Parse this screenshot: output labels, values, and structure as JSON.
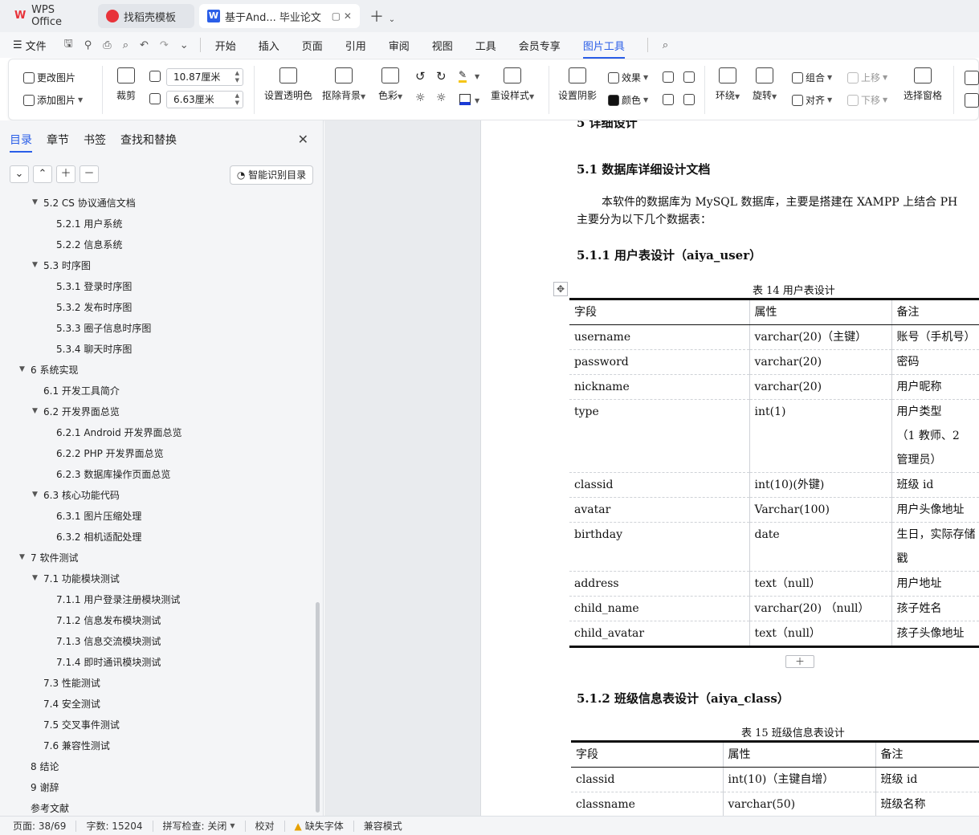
{
  "tabs": {
    "wps": "WPS Office",
    "template": "找稻壳模板",
    "doc": "基于And... 毕业论文"
  },
  "menu": {
    "file": "文件",
    "items": [
      "开始",
      "插入",
      "页面",
      "引用",
      "审阅",
      "视图",
      "工具",
      "会员专享",
      "图片工具"
    ],
    "active": "图片工具"
  },
  "ribbon": {
    "change_image": "更改图片",
    "add_image": "添加图片",
    "crop": "裁剪",
    "cut": "裁剪",
    "width": "10.87厘米",
    "height": "6.63厘米",
    "set_transparent": "设置透明色",
    "remove_bg": "抠除背景",
    "color": "色彩",
    "preset_style": "重设样式",
    "set_shadow": "设置阴影",
    "effect": "效果",
    "fill_color": "颜色",
    "wrap": "环绕",
    "rotate": "旋转",
    "group": "组合",
    "align": "对齐",
    "move_up": "上移",
    "move_down": "下移",
    "select_pane": "选择窗格"
  },
  "panel": {
    "tabs": [
      "目录",
      "章节",
      "书签",
      "查找和替换"
    ],
    "smart_toc": "智能识别目录",
    "toc": [
      {
        "text": "5.2  CS 协议通信文档",
        "level": 2,
        "arrow": true
      },
      {
        "text": "5.2.1  用户系统",
        "level": 3
      },
      {
        "text": "5.2.2  信息系统",
        "level": 3
      },
      {
        "text": "5.3  时序图",
        "level": 2,
        "arrow": true
      },
      {
        "text": "5.3.1  登录时序图",
        "level": 3
      },
      {
        "text": "5.3.2  发布时序图",
        "level": 3
      },
      {
        "text": "5.3.3  圈子信息时序图",
        "level": 3
      },
      {
        "text": "5.3.4  聊天时序图",
        "level": 3
      },
      {
        "text": "6  系统实现",
        "level": 1,
        "arrow": true
      },
      {
        "text": "6.1  开发工具简介",
        "level": 2
      },
      {
        "text": "6.2  开发界面总览",
        "level": 2,
        "arrow": true
      },
      {
        "text": "6.2.1  Android 开发界面总览",
        "level": 3
      },
      {
        "text": "6.2.2  PHP 开发界面总览",
        "level": 3
      },
      {
        "text": "6.2.3  数据库操作页面总览",
        "level": 3
      },
      {
        "text": "6.3  核心功能代码",
        "level": 2,
        "arrow": true
      },
      {
        "text": "6.3.1  图片压缩处理",
        "level": 3
      },
      {
        "text": "6.3.2  相机适配处理",
        "level": 3
      },
      {
        "text": "7  软件测试",
        "level": 1,
        "arrow": true
      },
      {
        "text": "7.1  功能模块测试",
        "level": 2,
        "arrow": true
      },
      {
        "text": "7.1.1  用户登录注册模块测试",
        "level": 3
      },
      {
        "text": "7.1.2  信息发布模块测试",
        "level": 3
      },
      {
        "text": "7.1.3  信息交流模块测试",
        "level": 3
      },
      {
        "text": "7.1.4  即时通讯模块测试",
        "level": 3
      },
      {
        "text": "7.3  性能测试",
        "level": 2
      },
      {
        "text": "7.4  安全测试",
        "level": 2
      },
      {
        "text": "7.5  交叉事件测试",
        "level": 2
      },
      {
        "text": "7.6  兼容性测试",
        "level": 2
      },
      {
        "text": "8  结论",
        "level": 1
      },
      {
        "text": "9  谢辞",
        "level": 1
      },
      {
        "text": "参考文献",
        "level": 1
      }
    ]
  },
  "doc": {
    "chapter_heading": "5  详细设计",
    "h_51": "5.1  数据库详细设计文档",
    "para1_line1": "本软件的数据库为 MySQL 数据库，主要是搭建在 XAMPP 上结合 PH",
    "para1_line2": "主要分为以下几个数据表：",
    "h_511": "5.1.1  用户表设计（aiya_user）",
    "caption14": "表 14    用户表设计",
    "table14": {
      "header": [
        "字段",
        "属性",
        "备注"
      ],
      "rows": [
        [
          "username",
          "varchar(20)（主键）",
          "账号（手机号）"
        ],
        [
          "password",
          "varchar(20)",
          "密码"
        ],
        [
          "nickname",
          "varchar(20)",
          "用户昵称"
        ],
        [
          "type",
          "int(1)",
          "用户类型"
        ],
        [
          "",
          "",
          "（1 教师、2"
        ],
        [
          "",
          "",
          "管理员）"
        ],
        [
          "classid",
          "int(10)(外键)",
          "班级 id"
        ],
        [
          "avatar",
          "Varchar(100)",
          "用户头像地址"
        ],
        [
          "birthday",
          "date",
          "生日，实际存储"
        ],
        [
          "",
          "",
          "戳"
        ],
        [
          "address",
          "text（null）",
          "用户地址"
        ],
        [
          "child_name",
          "varchar(20) （null）",
          "孩子姓名"
        ],
        [
          "child_avatar",
          "text（null）",
          "孩子头像地址"
        ]
      ]
    },
    "h_512": "5.1.2  班级信息表设计（aiya_class）",
    "caption15": "表 15    班级信息表设计",
    "table15": {
      "header": [
        "字段",
        "属性",
        "备注"
      ],
      "rows": [
        [
          "classid",
          "int(10)（主键自增）",
          "班级 id"
        ],
        [
          "classname",
          "varchar(50)",
          "班级名称"
        ]
      ]
    }
  },
  "status": {
    "page": "页面: 38/69",
    "words": "字数: 15204",
    "spell": "拼写检查: 关闭",
    "proof": "校对",
    "missing_font": "缺失字体",
    "compat": "兼容模式"
  }
}
